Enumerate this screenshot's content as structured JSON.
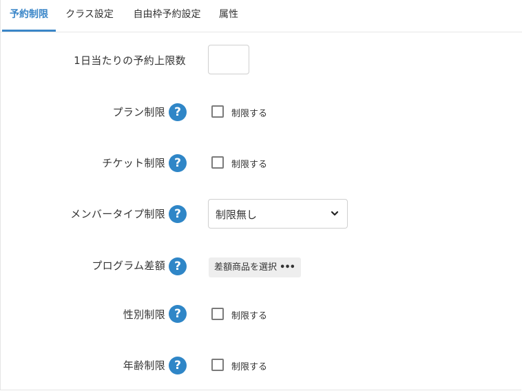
{
  "tabs": [
    {
      "label": "予約制限",
      "active": true
    },
    {
      "label": "クラス設定",
      "active": false
    },
    {
      "label": "自由枠予約設定",
      "active": false
    },
    {
      "label": "属性",
      "active": false
    }
  ],
  "form": {
    "daily_limit": {
      "label": "1日当たりの予約上限数",
      "value": ""
    },
    "plan_limit": {
      "label": "プラン制限",
      "checkbox_label": "制限する",
      "checked": false
    },
    "ticket_limit": {
      "label": "チケット制限",
      "checkbox_label": "制限する",
      "checked": false
    },
    "member_type_limit": {
      "label": "メンバータイプ制限",
      "selected": "制限無し"
    },
    "program_diff": {
      "label": "プログラム差額",
      "button_label": "差額商品を選択",
      "button_dots": "•••"
    },
    "gender_limit": {
      "label": "性別制限",
      "checkbox_label": "制限する",
      "checked": false
    },
    "age_limit": {
      "label": "年齢制限",
      "checkbox_label": "制限する",
      "checked": false
    }
  },
  "help_icon_glyph": "?",
  "colors": {
    "accent": "#3a86c8",
    "help_icon": "#2f86c7"
  }
}
